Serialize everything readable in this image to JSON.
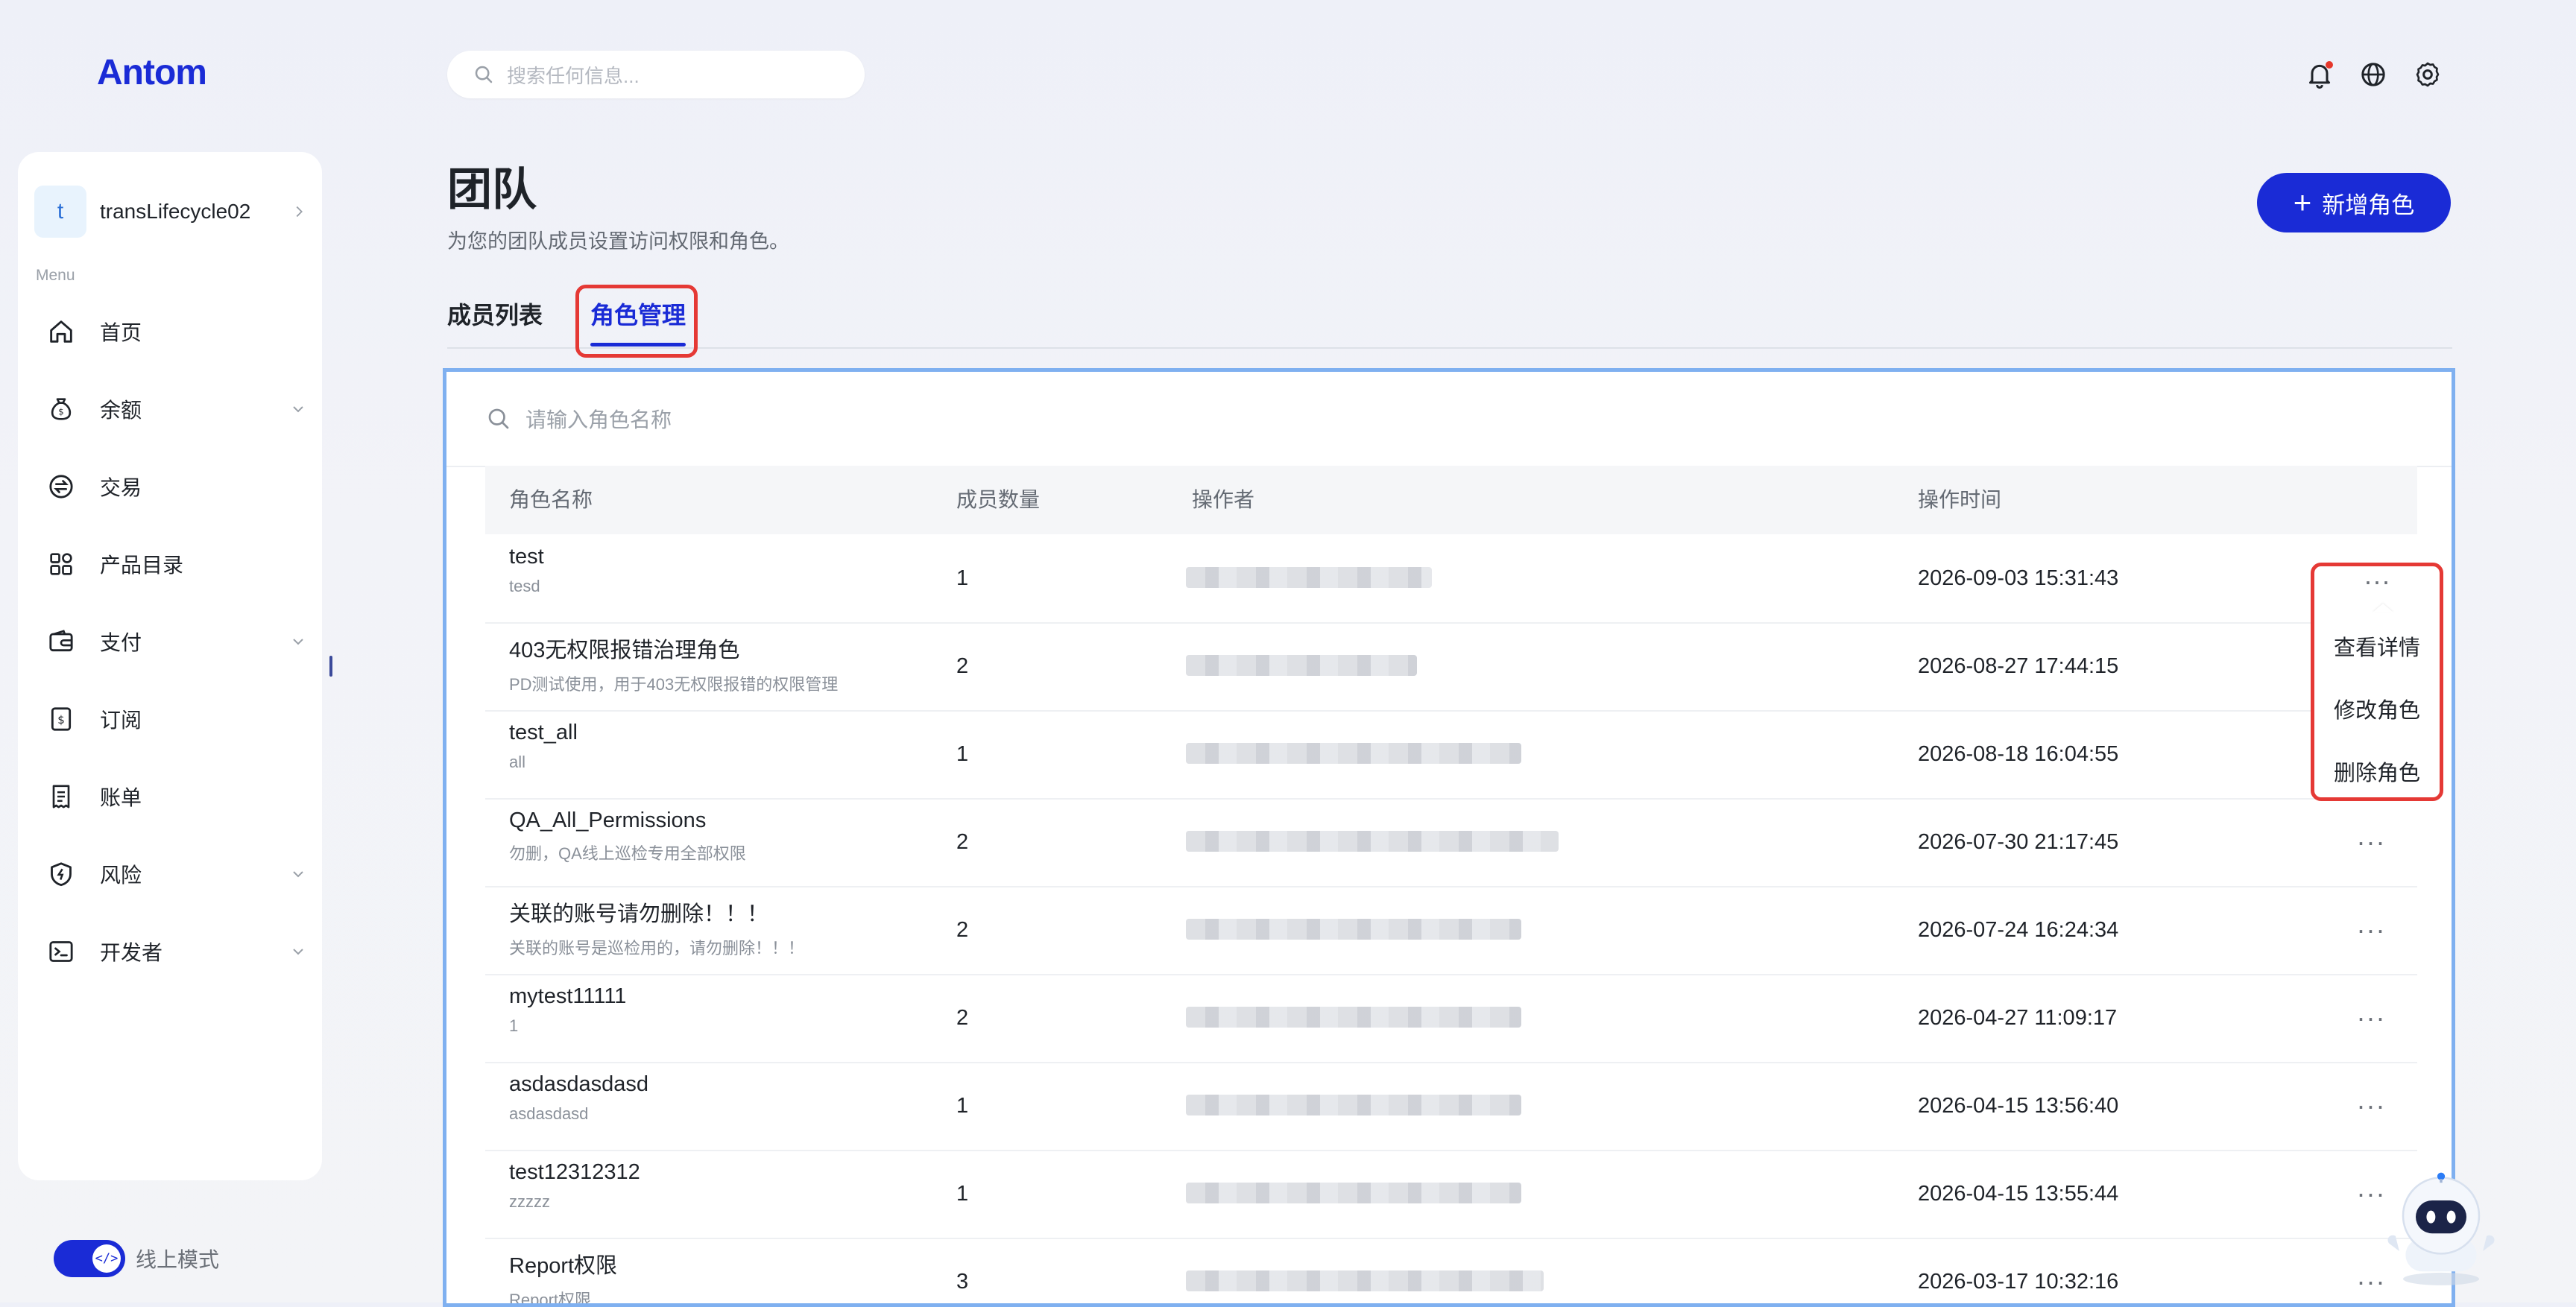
{
  "brand": {
    "logo": "Antom"
  },
  "search": {
    "placeholder": "搜索任何信息..."
  },
  "sidebar": {
    "account": {
      "initial": "t",
      "name": "transLifecycle02"
    },
    "menu_caption": "Menu",
    "items": [
      {
        "label": "首页",
        "icon": "home-icon",
        "has_dropdown": false
      },
      {
        "label": "余额",
        "icon": "money-bag-icon",
        "has_dropdown": true
      },
      {
        "label": "交易",
        "icon": "exchange-icon",
        "has_dropdown": false
      },
      {
        "label": "产品目录",
        "icon": "grid-icon",
        "has_dropdown": false
      },
      {
        "label": "支付",
        "icon": "wallet-icon",
        "has_dropdown": true
      },
      {
        "label": "订阅",
        "icon": "subscription-icon",
        "has_dropdown": false
      },
      {
        "label": "账单",
        "icon": "bill-icon",
        "has_dropdown": false
      },
      {
        "label": "风险",
        "icon": "shield-icon",
        "has_dropdown": true
      },
      {
        "label": "开发者",
        "icon": "terminal-icon",
        "has_dropdown": true
      }
    ],
    "mode_label": "线上模式",
    "mode_toggle_glyph": "</>"
  },
  "page": {
    "title": "团队",
    "subtitle": "为您的团队成员设置访问权限和角色。",
    "new_role_button": "新增角色",
    "tabs": [
      {
        "label": "成员列表",
        "active": false
      },
      {
        "label": "角色管理",
        "active": true
      }
    ]
  },
  "roles_table": {
    "search_placeholder": "请输入角色名称",
    "columns": [
      "角色名称",
      "成员数量",
      "操作者",
      "操作时间"
    ],
    "rows": [
      {
        "name": "test",
        "desc": "tesd",
        "members": "1",
        "time": "2026-09-03 15:31:43"
      },
      {
        "name": "403无权限报错治理角色",
        "desc": "PD测试使用，用于403无权限报错的权限管理",
        "members": "2",
        "time": "2026-08-27 17:44:15"
      },
      {
        "name": "test_all",
        "desc": "all",
        "members": "1",
        "time": "2026-08-18 16:04:55"
      },
      {
        "name": "QA_All_Permissions",
        "desc": "勿删，QA线上巡检专用全部权限",
        "members": "2",
        "time": "2026-07-30 21:17:45"
      },
      {
        "name": "关联的账号请勿删除！！！",
        "desc": "关联的账号是巡检用的，请勿删除！！！",
        "members": "2",
        "time": "2026-07-24 16:24:34"
      },
      {
        "name": "mytest11111",
        "desc": "1",
        "members": "2",
        "time": "2026-04-27 11:09:17"
      },
      {
        "name": "asdasdasdasd",
        "desc": "asdasdasd",
        "members": "1",
        "time": "2026-04-15 13:56:40"
      },
      {
        "name": "test12312312",
        "desc": "zzzzz",
        "members": "1",
        "time": "2026-04-15 13:55:44"
      },
      {
        "name": "Report权限",
        "desc": "Report权限",
        "members": "3",
        "time": "2026-03-17 10:32:16"
      }
    ],
    "more_glyph": "···",
    "row_menu": [
      "查看详情",
      "修改角色",
      "删除角色"
    ]
  },
  "colors": {
    "brand": "#1a2bd6",
    "highlight": "#e53935",
    "panel_border": "#7fb0f0"
  }
}
